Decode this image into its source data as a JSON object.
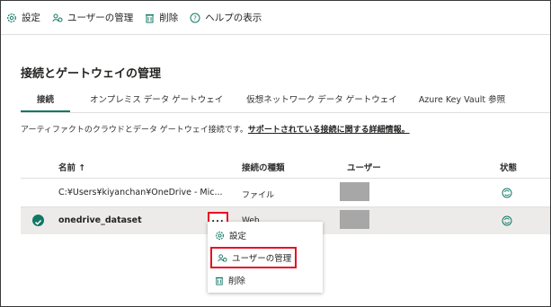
{
  "toolbar": {
    "settings": "設定",
    "manage_users": "ユーザーの管理",
    "delete": "削除",
    "help": "ヘルプの表示"
  },
  "page": {
    "title": "接続とゲートウェイの管理"
  },
  "tabs": [
    {
      "label": "接続",
      "active": true
    },
    {
      "label": "オンプレミス データ ゲートウェイ",
      "active": false
    },
    {
      "label": "仮想ネットワーク データ ゲートウェイ",
      "active": false
    },
    {
      "label": "Azure Key Vault 参照",
      "active": false
    }
  ],
  "description": {
    "text": "アーティファクトのクラウドとデータ ゲートウェイ接続です。",
    "link": "サポートされている接続に関する詳細情報。"
  },
  "table": {
    "headers": {
      "name": "名前 ↑",
      "type": "接続の種類",
      "user": "ユーザー",
      "status": "状態"
    },
    "rows": [
      {
        "name": "C:¥Users¥kiyanchan¥OneDrive - Mic...",
        "type": "ファイル",
        "selected": false
      },
      {
        "name": "onedrive_dataset",
        "type": "Web",
        "selected": true,
        "more": "..."
      }
    ]
  },
  "context_menu": {
    "items": [
      {
        "label": "設定",
        "icon": "gear-icon"
      },
      {
        "label": "ユーザーの管理",
        "icon": "manage-users-icon",
        "highlighted": true
      },
      {
        "label": "削除",
        "icon": "trash-icon"
      }
    ]
  },
  "colors": {
    "accent": "#117865",
    "highlight": "#e81123",
    "redacted": "#a7a7a7"
  }
}
